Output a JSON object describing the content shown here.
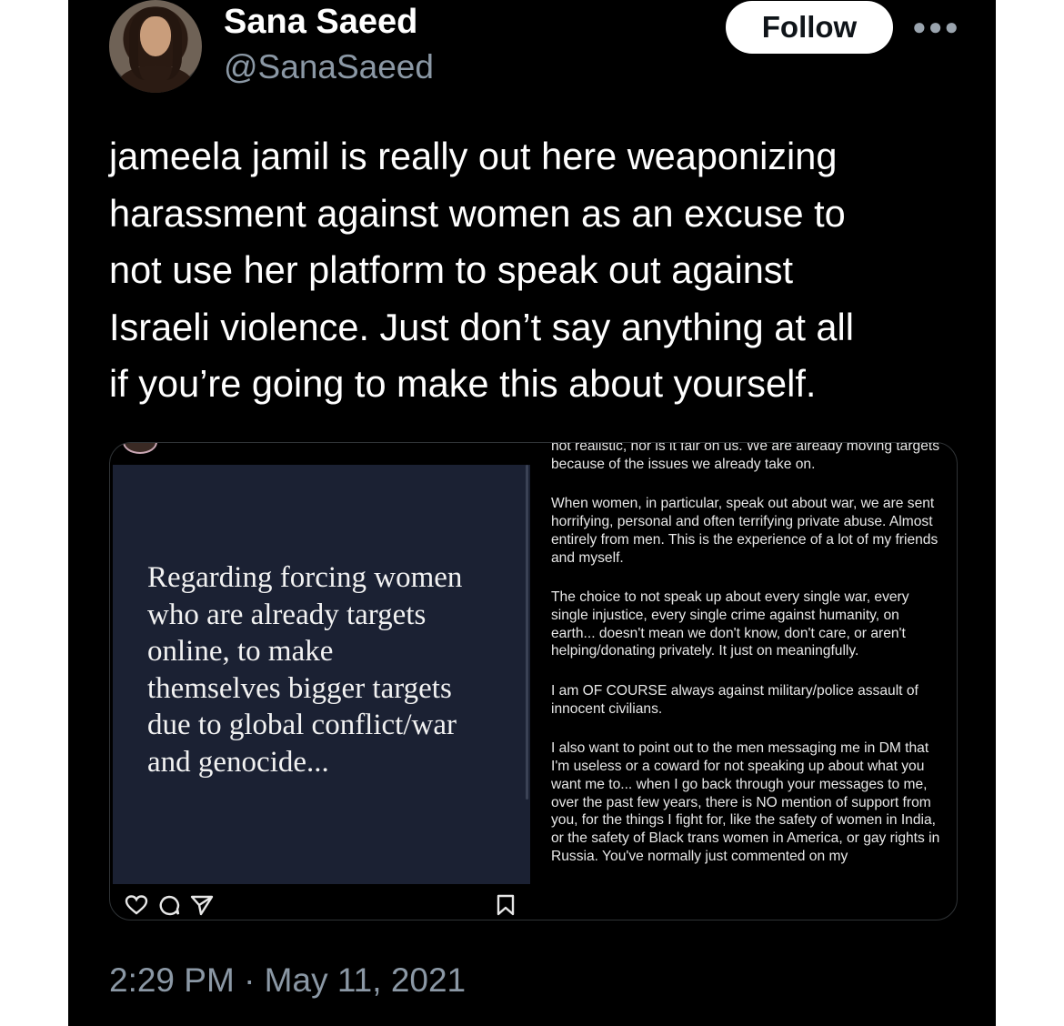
{
  "author": {
    "name": "Sana Saeed",
    "handle": "@SanaSaeed"
  },
  "follow_label": "Follow",
  "more_icon": "more-horizontal-icon",
  "tweet_text": "jameela jamil is really out here weaponizing\nharassment against women as an excuse to\nnot use her platform to speak out against\nIsraeli violence. Just don’t say anything at all\nif you’re going to make this about yourself.",
  "media": {
    "quote": "Regarding forcing women\nwho are already targets\nonline, to make\nthemselves bigger targets\ndue to global conflict/war\nand genocide...",
    "statement_paragraphs": [
      "not realistic, nor is it fair on us. We are already moving targets because of the issues we already take on.",
      "When women, in particular, speak out about war, we are sent horrifying, personal and often terrifying private abuse. Almost entirely from men. This is the experience of a lot of my friends and myself.",
      "The choice to not speak up about every single war, every single injustice, every single crime against humanity, on earth... doesn't mean we don't know, don't care, or aren't helping/donating privately. It just on meaningfully.",
      "I am OF COURSE always against military/police assault of innocent civilians.",
      "I also want to point out to the men messaging me in DM that I'm useless or a coward for not speaking up about what you want me to... when I go back through your messages to me, over the past few years, there is NO mention of support from you, for the things I fight for, like the safety of women in India, or the safety of Black trans women in America, or gay rights in Russia. You've normally just commented on my"
    ],
    "action_icons": [
      "heart-icon",
      "comment-icon",
      "share-icon",
      "bookmark-icon"
    ]
  },
  "timestamp": "2:29 PM · May 11, 2021"
}
